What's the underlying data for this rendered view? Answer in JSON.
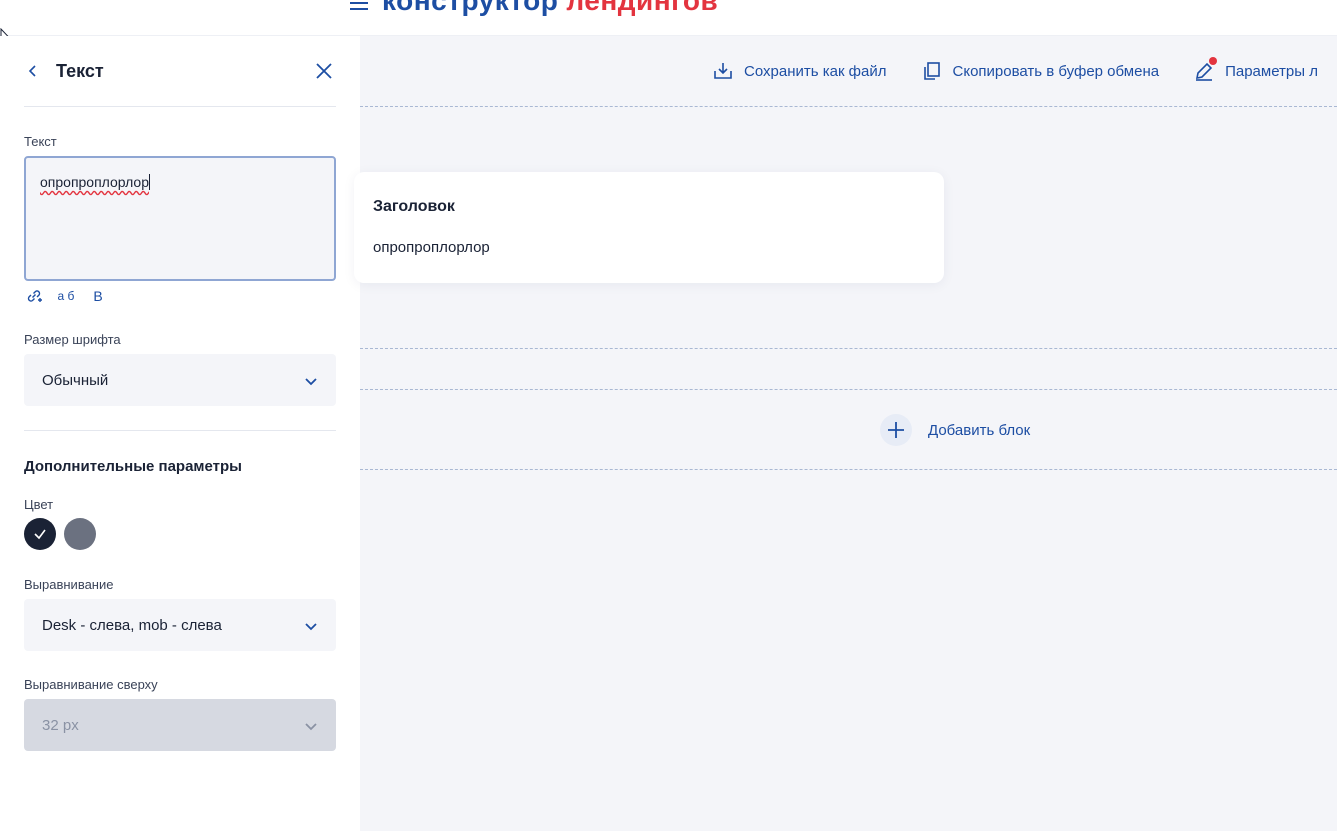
{
  "header": {
    "logo_part1": "конструктор",
    "logo_part2": "лендингов"
  },
  "panel": {
    "title": "Текст",
    "text_label": "Текст",
    "text_value": "опропроплорлор",
    "toolbar": {
      "subscript_label": "а б",
      "bold_label": "B"
    },
    "font_size_label": "Размер шрифта",
    "font_size_value": "Обычный",
    "advanced_title": "Дополнительные параметры",
    "color_label": "Цвет",
    "colors": [
      "#1a2235",
      "#6b7180"
    ],
    "align_label": "Выравнивание",
    "align_value": "Desk - слева, mob - слева",
    "top_align_label": "Выравнивание сверху",
    "top_align_value": "32 px"
  },
  "main": {
    "actions": {
      "save_file": "Сохранить как файл",
      "copy_buffer": "Скопировать в буфер обмена",
      "params": "Параметры л"
    },
    "card": {
      "title": "Заголовок",
      "text": "опропроплорлор"
    },
    "add_block": "Добавить блок"
  },
  "colors": {
    "accent": "#1d4ea3",
    "brand_red": "#e3343f",
    "text": "#1a2235"
  }
}
